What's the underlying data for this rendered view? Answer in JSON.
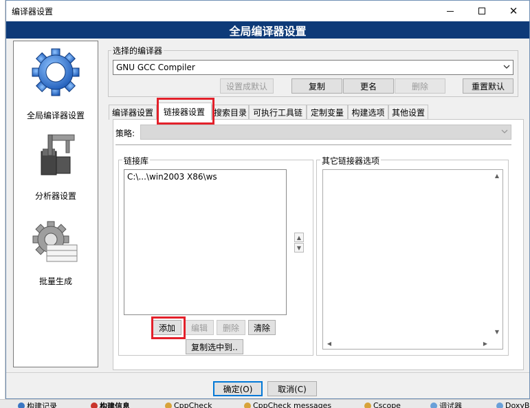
{
  "window": {
    "title": "编译器设置",
    "header": "全局编译器设置"
  },
  "nav": {
    "items": [
      {
        "label": "全局编译器设置",
        "icon": "gear-icon"
      },
      {
        "label": "分析器设置",
        "icon": "caliper-icon"
      },
      {
        "label": "批量生成",
        "icon": "batch-gear-icon"
      }
    ]
  },
  "compiler": {
    "group_label": "选择的编译器",
    "selected": "GNU GCC Compiler",
    "buttons": {
      "set_default": "设置成默认",
      "copy": "复制",
      "rename": "更名",
      "delete": "删除",
      "reset_default": "重置默认"
    }
  },
  "tabs": [
    "编译器设置",
    "链接器设置",
    "搜索目录",
    "可执行工具链",
    "定制变量",
    "构建选项",
    "其他设置"
  ],
  "linker": {
    "policy_label": "策略:",
    "libs_label": "链接库",
    "lib_entry": "C:\\...\\win2003 X86\\ws",
    "other_options_label": "其它链接器选项",
    "buttons": {
      "add": "添加",
      "edit": "编辑",
      "delete": "删除",
      "clear": "清除",
      "copy_selected": "复制选中到.."
    }
  },
  "footer": {
    "ok": "确定(O)",
    "cancel": "取消(C)"
  },
  "taskbar": {
    "items": [
      "构建记录",
      "构建信息",
      "CppCheck",
      "CppCheck messages",
      "Cscope",
      "调试器",
      "DoxyB"
    ]
  },
  "colors": {
    "header_bg": "#0e3a78",
    "highlight": "#e3202a"
  }
}
